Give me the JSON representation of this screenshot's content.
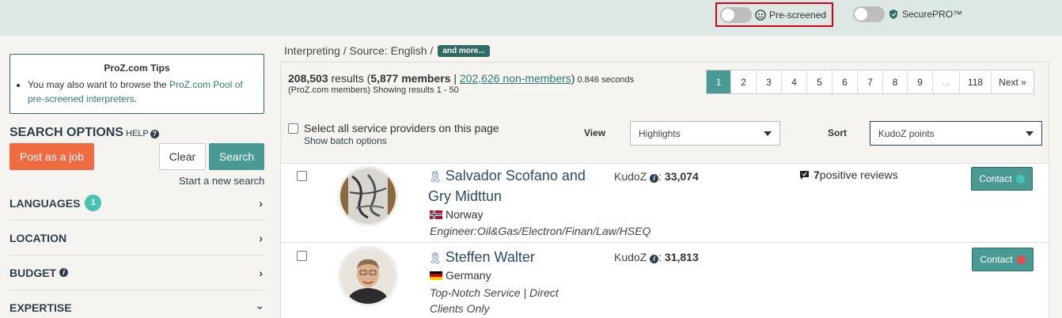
{
  "topbar": {
    "prescreened_label": "Pre-screened",
    "securepro_label": "SecurePRO™"
  },
  "tips": {
    "title": "ProZ.com Tips",
    "text_before": "You may also want to browse the ",
    "link": "ProZ.com Pool of pre-screened interpreters",
    "text_after": "."
  },
  "search_options": {
    "title": "SEARCH OPTIONS",
    "help": "HELP",
    "post_job": "Post as a job",
    "clear": "Clear",
    "search": "Search",
    "new_search": "Start a new search"
  },
  "facets": {
    "languages": "LANGUAGES",
    "languages_count": "1",
    "location": "LOCATION",
    "budget": "BUDGET",
    "expertise": "EXPERTISE"
  },
  "breadcrumb": {
    "text": "Interpreting / Source: English /",
    "more": "and more..."
  },
  "results": {
    "total": "208,503",
    "results_word": " results (",
    "members": "5,877 members",
    "sep": " | ",
    "non_members": "202,626 non-members",
    "close": ")",
    "seconds": " 0.846 seconds",
    "sub": "(ProZ.com members) Showing results 1 - 50"
  },
  "pager": [
    "1",
    "2",
    "3",
    "4",
    "5",
    "6",
    "7",
    "8",
    "9",
    "...",
    "118",
    "Next »"
  ],
  "controls": {
    "select_all": "Select all service providers on this page",
    "batch": "Show batch options",
    "view_label": "View",
    "view_value": "Highlights",
    "sort_label": "Sort",
    "sort_value": "KudoZ points"
  },
  "providers": [
    {
      "name": "Salvador Scofano and Gry Midttun",
      "country": "Norway",
      "specialty": "Engineer:Oil&Gas/Electron/Finan/Law/HSEQ",
      "kudoz_label": "KudoZ",
      "kudoz_points": "33,074",
      "reviews_count": "7",
      "reviews_text": " positive reviews",
      "contact": "Contact",
      "status_color": "#47c3b3"
    },
    {
      "name": "Steffen Walter",
      "country": "Germany",
      "specialty": "Top-Notch Service | Direct Clients Only",
      "kudoz_label": "KudoZ",
      "kudoz_points": "31,813",
      "contact": "Contact",
      "status_color": "#e84c4c"
    }
  ]
}
